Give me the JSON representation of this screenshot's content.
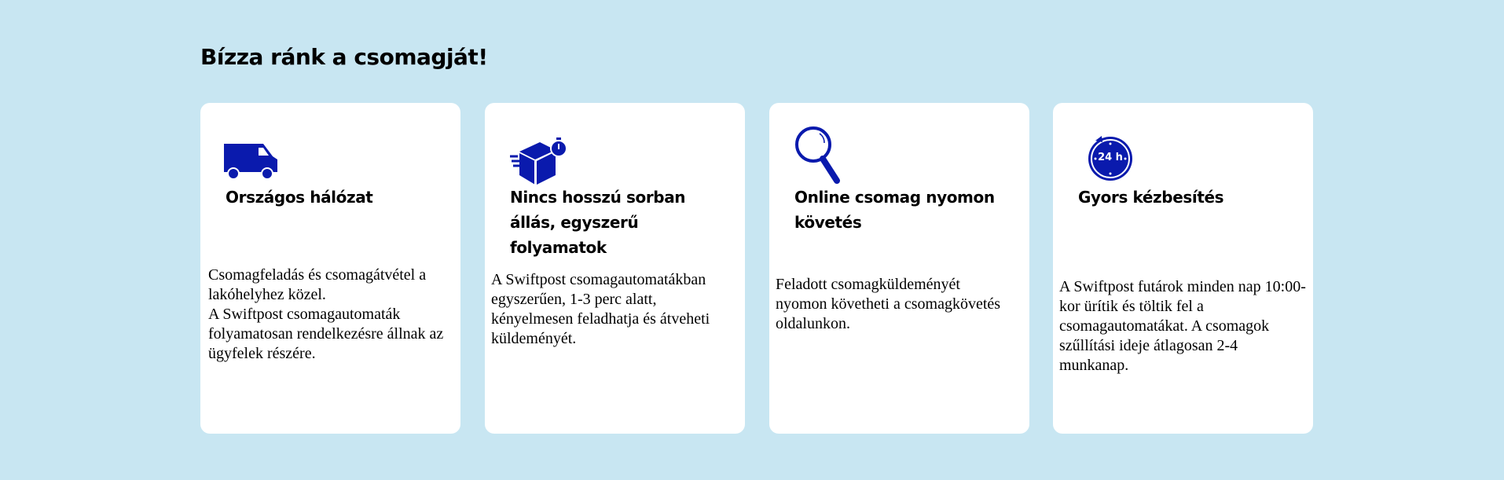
{
  "section_title": "Bízza ránk a csomagját!",
  "accent_color": "#0a1aad",
  "cards": [
    {
      "icon": "delivery-van-icon",
      "title": "Országos hálózat",
      "text": "Csomagfeladás és csomagátvétel a\n lakóhelyhez közel.\nA Swiftpost csomagautomaták folyamatosan rendelkezésre állnak az ügyfelek részére."
    },
    {
      "icon": "fast-package-icon",
      "title": "Nincs hosszú sorban állás, egyszerű folyamatok",
      "text": "A Swiftpost csomagautomatákban egyszerűen, 1-3 perc alatt, kényelmesen feladhatja és átveheti küldeményét."
    },
    {
      "icon": "magnifier-icon",
      "title": "Online csomag nyomon követés",
      "text": "Feladott csomagküldeményét nyomon követheti a csomagkövetés oldalunkon."
    },
    {
      "icon": "clock-24h-icon",
      "title": "Gyors kézbesítés",
      "icon_label": "24 h",
      "text": "A Swiftpost futárok minden nap 10:00-kor ürítik és töltik fel a csomagautomatákat. A csomagok szűllítási ideje átlagosan 2-4 munkanap."
    }
  ]
}
